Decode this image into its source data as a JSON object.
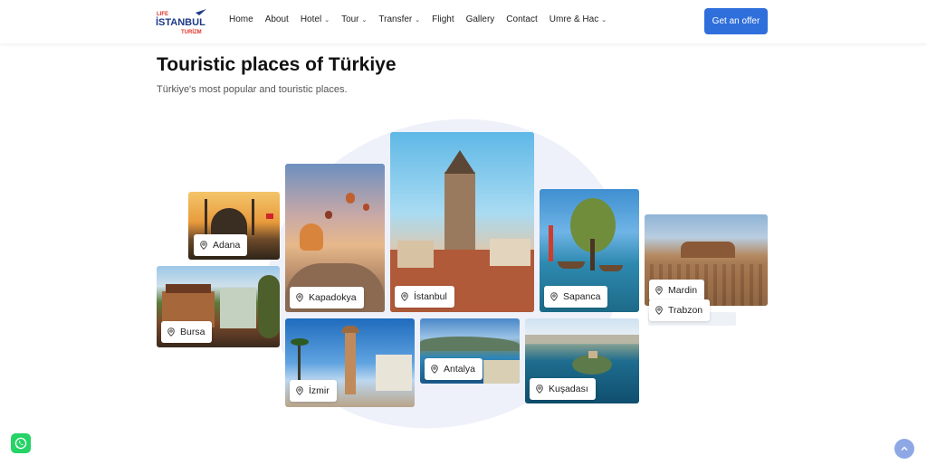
{
  "logo": {
    "line1": "LIFE",
    "line2": "İSTANBUL",
    "line3": "TURİZM"
  },
  "nav": {
    "home": "Home",
    "about": "About",
    "hotel": "Hotel",
    "tour": "Tour",
    "transfer": "Transfer",
    "flight": "Flight",
    "gallery": "Gallery",
    "contact": "Contact",
    "umre": "Umre & Hac",
    "cta": "Get an offer"
  },
  "section": {
    "title": "Touristic places of Türkiye",
    "subtitle": "Türkiye's most popular and touristic places."
  },
  "places": {
    "adana": "Adana",
    "bursa": "Bursa",
    "kapadokya": "Kapadokya",
    "izmir": "İzmir",
    "istanbul": "İstanbul",
    "antalya": "Antalya",
    "sapanca": "Sapanca",
    "kusadasi": "Kuşadası",
    "mardin": "Mardin",
    "trabzon": "Trabzon"
  },
  "colors": {
    "accent": "#2f6fdb",
    "whatsapp": "#25d366",
    "scroll_top": "#8ea8e6"
  },
  "icons": {
    "pin": "map-pin-icon",
    "whatsapp": "whatsapp-icon",
    "scroll_top": "chevron-up-icon"
  }
}
